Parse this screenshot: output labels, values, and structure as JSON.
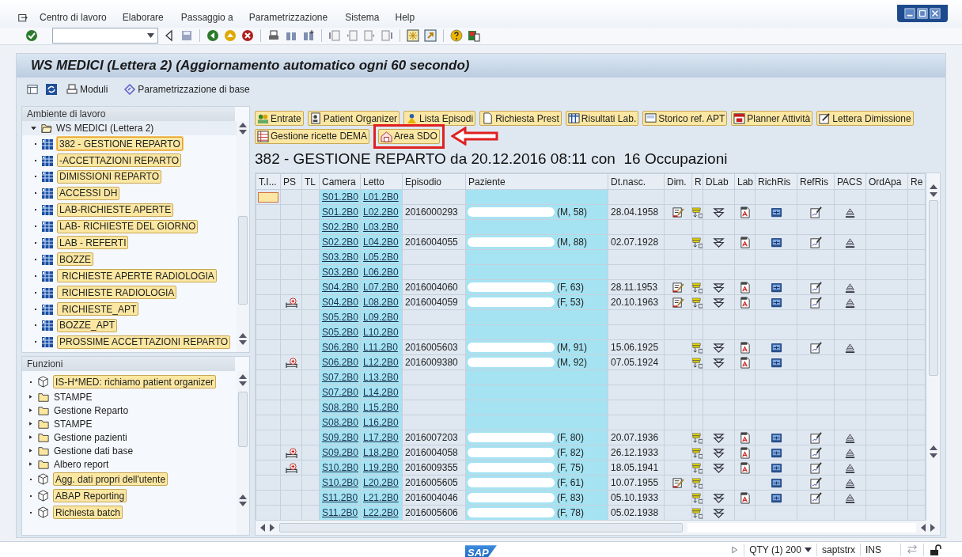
{
  "menu_bar": {
    "items": [
      "Centro di lavoro",
      "Elaborare",
      "Passaggio a",
      "Parametrizzazione",
      "Sistema",
      "Help"
    ]
  },
  "window": {
    "title": "WS MEDICI (Lettera 2) (Aggiornamento automatico ogni 60 secondo)"
  },
  "app_toolbar": {
    "buttons": [
      {
        "label": "Moduli",
        "kind": "print"
      },
      {
        "label": "Parametrizzazione di base",
        "kind": "settings"
      }
    ]
  },
  "workspace_panel": {
    "title": "Ambiente di lavoro",
    "root": {
      "label": "WS MEDICI (Lettera 2)",
      "expanded": true,
      "children": [
        {
          "label": "382 - GESTIONE REPARTO",
          "selected": true
        },
        {
          "label": "-ACCETTAZIONI REPARTO",
          "selected": false
        },
        {
          "label": "DIMISSIONI REPARTO",
          "selected": false
        },
        {
          "label": "ACCESSI DH",
          "selected": false
        },
        {
          "label": "LAB-RICHIESTE APERTE",
          "selected": false
        },
        {
          "label": "LAB- RICHIESTE DEL GIORNO",
          "selected": false
        },
        {
          "label": "LAB - REFERTI",
          "selected": false
        },
        {
          "label": "BOZZE",
          "selected": false
        },
        {
          "label": " RICHIESTE APERTE RADIOLOGIA",
          "selected": false
        },
        {
          "label": " RICHIESTE RADIOLOGIA",
          "selected": false
        },
        {
          "label": " RICHIESTE_APT",
          "selected": false
        },
        {
          "label": "BOZZE_APT",
          "selected": false
        },
        {
          "label": "PROSSIME ACCETTAZIONI REPARTO",
          "selected": false
        }
      ]
    }
  },
  "functions_panel": {
    "title": "Funzioni",
    "items": [
      {
        "label": "IS-H*MED: richiamo patient organizer",
        "kind": "function"
      },
      {
        "label": "STAMPE",
        "kind": "folder"
      },
      {
        "label": "Gestione Reparto",
        "kind": "folder"
      },
      {
        "label": "STAMPE",
        "kind": "folder"
      },
      {
        "label": "Gestione pazienti",
        "kind": "folder"
      },
      {
        "label": "Gestione dati base",
        "kind": "folder"
      },
      {
        "label": "Albero report",
        "kind": "folder"
      },
      {
        "label": "Agg. dati propri dell'utente",
        "kind": "function"
      },
      {
        "label": "ABAP Reporting",
        "kind": "function"
      },
      {
        "label": "Richiesta batch",
        "kind": "function"
      }
    ]
  },
  "action_buttons": [
    {
      "label": "Entrate",
      "kind": "people",
      "highlighted": false
    },
    {
      "label": "Patient Organizer",
      "kind": "organizer",
      "highlighted": false
    },
    {
      "label": "Lista Episodi",
      "kind": "person",
      "highlighted": false
    },
    {
      "label": "Richiesta Prest",
      "kind": "document",
      "highlighted": false
    },
    {
      "label": "Risultati Lab.",
      "kind": "grid",
      "highlighted": false
    },
    {
      "label": "Storico ref. APT",
      "kind": "screen",
      "highlighted": false
    },
    {
      "label": "Planner Attività",
      "kind": "calendar",
      "highlighted": false
    },
    {
      "label": "Lettera Dimissione",
      "kind": "letter",
      "highlighted": false
    },
    {
      "label": "Gestione ricette DEMA",
      "kind": "table",
      "highlighted": false
    },
    {
      "label": "Area SDO",
      "kind": "house",
      "highlighted": true
    }
  ],
  "heading": "382 - GESTIONE REPARTO da 20.12.2016 08:11 con  16 Occupazioni",
  "table": {
    "columns": [
      "T.I...",
      "PS",
      "TL",
      "Camera",
      "Letto",
      "Episodio",
      "Paziente",
      "Dt.nasc.",
      "Dim.",
      "R",
      "DLab",
      "Lab",
      "RichRis",
      "RefRis",
      "PACS",
      "OrdApa",
      "Re"
    ],
    "rows": [
      {
        "camera": "S01.2B0",
        "letto": "L01.2B0",
        "selected": true,
        "ps": false,
        "dim": false,
        "r": false,
        "dlab": false,
        "lab": false,
        "richris": false,
        "refris": false,
        "pacs": false
      },
      {
        "camera": "S01.2B0",
        "letto": "L02.2B0",
        "episodio": "2016000293",
        "paziente": "(M, 58)",
        "dt_nasc": "28.04.1958",
        "selected": false,
        "ps": false,
        "dim": true,
        "r": true,
        "dlab": true,
        "lab": true,
        "richris": true,
        "refris": true,
        "pacs": true
      },
      {
        "camera": "S02.2B0",
        "letto": "L03.2B0",
        "selected": false,
        "ps": false,
        "dim": false,
        "r": false,
        "dlab": false,
        "lab": false,
        "richris": false,
        "refris": false,
        "pacs": false
      },
      {
        "camera": "S02.2B0",
        "letto": "L04.2B0",
        "episodio": "2016004055",
        "paziente": "(M, 88)",
        "dt_nasc": "02.07.1928",
        "selected": false,
        "ps": false,
        "dim": false,
        "r": true,
        "dlab": true,
        "lab": true,
        "richris": true,
        "refris": true,
        "pacs": true
      },
      {
        "camera": "S03.2B0",
        "letto": "L05.2B0",
        "selected": false,
        "ps": false,
        "dim": false,
        "r": false,
        "dlab": false,
        "lab": false,
        "richris": false,
        "refris": false,
        "pacs": false
      },
      {
        "camera": "S03.2B0",
        "letto": "L06.2B0",
        "selected": false,
        "ps": false,
        "dim": false,
        "r": false,
        "dlab": false,
        "lab": false,
        "richris": false,
        "refris": false,
        "pacs": false
      },
      {
        "camera": "S04.2B0",
        "letto": "L07.2B0",
        "episodio": "2016004060",
        "paziente": "(F, 63)",
        "dt_nasc": "28.11.1953",
        "selected": false,
        "ps": false,
        "dim": true,
        "r": true,
        "dlab": true,
        "lab": true,
        "richris": true,
        "refris": true,
        "pacs": true
      },
      {
        "camera": "S04.2B0",
        "letto": "L08.2B0",
        "episodio": "2016004059",
        "paziente": "(F, 53)",
        "dt_nasc": "20.10.1963",
        "selected": false,
        "ps": true,
        "dim": true,
        "r": true,
        "dlab": true,
        "lab": true,
        "richris": true,
        "refris": true,
        "pacs": true
      },
      {
        "camera": "S05.2B0",
        "letto": "L09.2B0",
        "selected": false,
        "ps": false,
        "dim": false,
        "r": false,
        "dlab": false,
        "lab": false,
        "richris": false,
        "refris": false,
        "pacs": false
      },
      {
        "camera": "S05.2B0",
        "letto": "L10.2B0",
        "selected": false,
        "ps": false,
        "dim": false,
        "r": false,
        "dlab": false,
        "lab": false,
        "richris": false,
        "refris": false,
        "pacs": false
      },
      {
        "camera": "S06.2B0",
        "letto": "L11.2B0",
        "episodio": "2016005603",
        "paziente": "(M, 91)",
        "dt_nasc": "15.06.1925",
        "selected": false,
        "ps": false,
        "dim": false,
        "r": true,
        "dlab": true,
        "lab": true,
        "richris": true,
        "refris": true,
        "pacs": true
      },
      {
        "camera": "S06.2B0",
        "letto": "L12.2B0",
        "episodio": "2016009380",
        "paziente": "(M, 92)",
        "dt_nasc": "07.05.1924",
        "selected": false,
        "ps": true,
        "dim": false,
        "r": true,
        "dlab": true,
        "lab": true,
        "richris": true,
        "refris": false,
        "pacs": false
      },
      {
        "camera": "S07.2B0",
        "letto": "L13.2B0",
        "selected": false,
        "ps": false,
        "dim": false,
        "r": false,
        "dlab": false,
        "lab": false,
        "richris": false,
        "refris": false,
        "pacs": false
      },
      {
        "camera": "S07.2B0",
        "letto": "L14.2B0",
        "selected": false,
        "ps": false,
        "dim": false,
        "r": false,
        "dlab": false,
        "lab": false,
        "richris": false,
        "refris": false,
        "pacs": false
      },
      {
        "camera": "S08.2B0",
        "letto": "L15.2B0",
        "selected": false,
        "ps": false,
        "dim": false,
        "r": false,
        "dlab": false,
        "lab": false,
        "richris": false,
        "refris": false,
        "pacs": false
      },
      {
        "camera": "S08.2B0",
        "letto": "L16.2B0",
        "selected": false,
        "ps": false,
        "dim": false,
        "r": false,
        "dlab": false,
        "lab": false,
        "richris": false,
        "refris": false,
        "pacs": false
      },
      {
        "camera": "S09.2B0",
        "letto": "L17.2B0",
        "episodio": "2016007203",
        "paziente": "(F, 80)",
        "dt_nasc": "20.07.1936",
        "selected": false,
        "ps": false,
        "dim": false,
        "r": true,
        "dlab": true,
        "lab": true,
        "richris": true,
        "refris": true,
        "pacs": true
      },
      {
        "camera": "S09.2B0",
        "letto": "L18.2B0",
        "episodio": "2016004058",
        "paziente": "(F, 82)",
        "dt_nasc": "26.12.1933",
        "selected": false,
        "ps": true,
        "dim": false,
        "r": true,
        "dlab": true,
        "lab": true,
        "richris": true,
        "refris": true,
        "pacs": true
      },
      {
        "camera": "S10.2B0",
        "letto": "L19.2B0",
        "episodio": "2016009355",
        "paziente": "(F, 75)",
        "dt_nasc": "18.05.1941",
        "selected": false,
        "ps": true,
        "dim": false,
        "r": true,
        "dlab": true,
        "lab": true,
        "richris": true,
        "refris": true,
        "pacs": true
      },
      {
        "camera": "S10.2B0",
        "letto": "L20.2B0",
        "episodio": "2016005605",
        "paziente": "(F, 61)",
        "dt_nasc": "10.07.1955",
        "selected": false,
        "ps": false,
        "dim": true,
        "r": true,
        "dlab": false,
        "lab": false,
        "richris": true,
        "refris": true,
        "pacs": true
      },
      {
        "camera": "S11.2B0",
        "letto": "L21.2B0",
        "episodio": "2016004046",
        "paziente": "(F, 83)",
        "dt_nasc": "05.10.1933",
        "selected": false,
        "ps": false,
        "dim": false,
        "r": true,
        "dlab": true,
        "lab": true,
        "richris": true,
        "refris": true,
        "pacs": true
      },
      {
        "camera": "S11.2B0",
        "letto": "L22.2B0",
        "episodio": "2016005606",
        "paziente": "(F, 78)",
        "dt_nasc": "05.02.1938",
        "selected": false,
        "ps": false,
        "dim": false,
        "r": true,
        "dlab": true,
        "lab": false,
        "richris": false,
        "refris": false,
        "pacs": false
      }
    ]
  },
  "status_bar": {
    "logo": "SAP",
    "items": [
      "QTY (1) 200",
      "saptstrx",
      "INS"
    ]
  }
}
